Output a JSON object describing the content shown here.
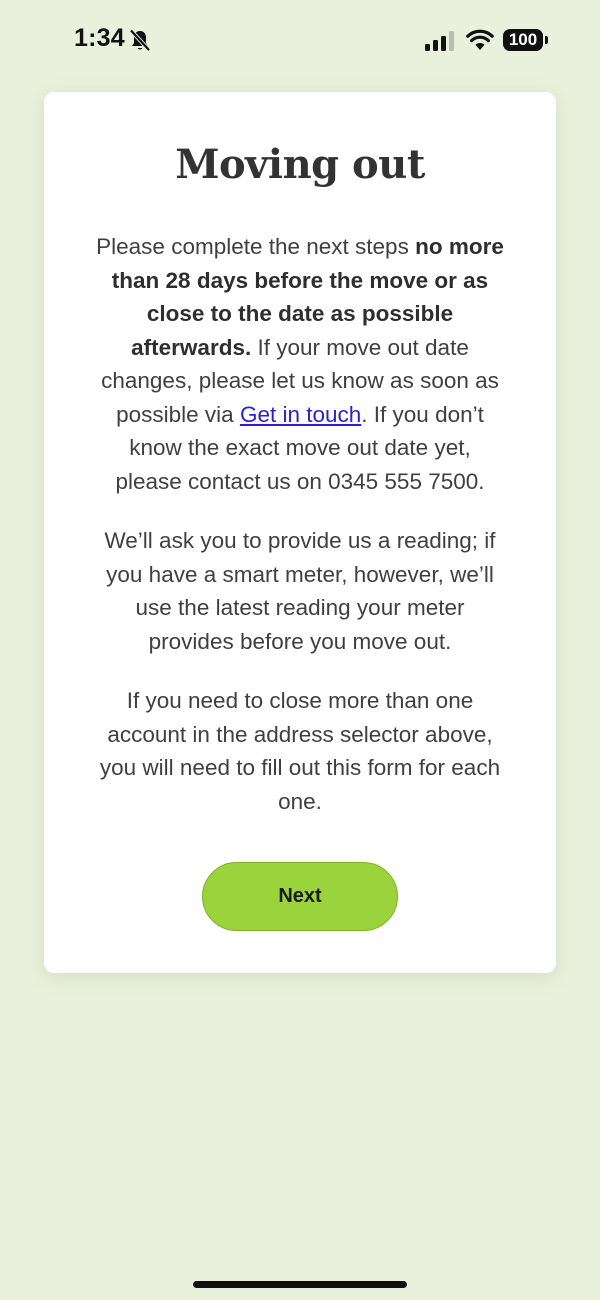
{
  "status_bar": {
    "time": "1:34",
    "bell_icon": "bell-slash-icon",
    "signal_icon": "cellular-signal-icon",
    "wifi_icon": "wifi-icon",
    "battery_level": "100"
  },
  "card": {
    "title": "Moving out",
    "paragraph1": {
      "intro": "Please complete the next steps ",
      "bold": "no more than 28 days before the move or as close to the date as possible afterwards.",
      "middle": " If your move out date changes, please let us know as soon as possible via ",
      "link": "Get in touch",
      "outro": ". If you don’t know the exact move out date yet, please contact us on 0345 555 7500."
    },
    "paragraph2": "We’ll ask you to provide us a reading; if you have a smart meter, however, we’ll use the latest reading your meter provides before you move out.",
    "paragraph3": "If you need to close more than one account in the address selector above, you will need to fill out this form for each one.",
    "next_label": "Next"
  },
  "colors": {
    "background": "#e9f1dc",
    "card": "#ffffff",
    "button": "#9bd33c",
    "link": "#2a1fd1"
  }
}
